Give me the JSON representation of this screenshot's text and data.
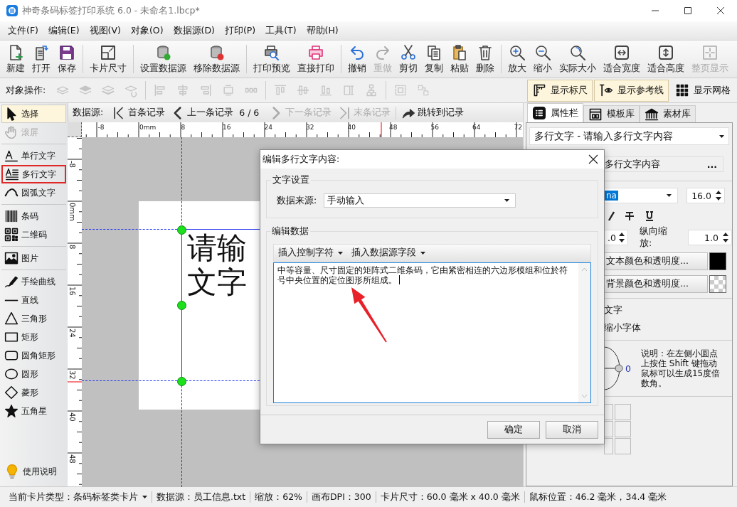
{
  "window": {
    "title": "神奇条码标签打印系统 6.0 - 未命名1.lbcp*"
  },
  "menu": [
    "文件(F)",
    "编辑(E)",
    "视图(V)",
    "对象(O)",
    "数据源(D)",
    "打印(P)",
    "工具(T)",
    "帮助(H)"
  ],
  "toolbar": [
    [
      {
        "label": "新建",
        "disabled": false
      },
      {
        "label": "打开",
        "disabled": false
      },
      {
        "label": "保存",
        "disabled": false
      }
    ],
    [
      {
        "label": "卡片尺寸",
        "disabled": false
      }
    ],
    [
      {
        "label": "设置数据源",
        "disabled": false
      },
      {
        "label": "移除数据源",
        "disabled": false
      }
    ],
    [
      {
        "label": "打印预览",
        "disabled": false
      },
      {
        "label": "直接打印",
        "disabled": false
      }
    ],
    [
      {
        "label": "撤销",
        "disabled": false
      },
      {
        "label": "重做",
        "disabled": true
      },
      {
        "label": "剪切",
        "disabled": false
      },
      {
        "label": "复制",
        "disabled": false
      },
      {
        "label": "粘贴",
        "disabled": false
      },
      {
        "label": "删除",
        "disabled": false
      }
    ],
    [
      {
        "label": "放大",
        "disabled": false
      },
      {
        "label": "缩小",
        "disabled": false
      },
      {
        "label": "实际大小",
        "disabled": false
      },
      {
        "label": "适合宽度",
        "disabled": false
      },
      {
        "label": "适合高度",
        "disabled": false
      },
      {
        "label": "整页显示",
        "disabled": true
      }
    ]
  ],
  "object_toolbar": {
    "label": "对象操作:",
    "tools": [
      [
        {
          "disabled": true
        },
        {
          "disabled": true
        },
        {
          "disabled": true
        },
        {
          "disabled": true
        }
      ],
      [
        {
          "disabled": true
        },
        {
          "disabled": true
        },
        {
          "disabled": true
        },
        {
          "disabled": true
        },
        {
          "disabled": true
        }
      ],
      [
        {
          "disabled": true
        },
        {
          "disabled": true
        },
        {
          "disabled": true
        },
        {
          "disabled": true
        },
        {
          "disabled": true
        }
      ],
      [
        {
          "disabled": true
        },
        {
          "disabled": true
        }
      ]
    ],
    "toggles": [
      {
        "label": "显示标尺",
        "on": true
      },
      {
        "label": "显示参考线",
        "on": true
      },
      {
        "label": "显示网格",
        "on": false
      }
    ]
  },
  "tools": [
    [
      {
        "label": "选择",
        "selected": true,
        "disabled": false,
        "highlighted": false
      },
      {
        "label": "滚屏",
        "selected": false,
        "disabled": true,
        "highlighted": false
      }
    ],
    [
      {
        "label": "单行文字",
        "selected": false,
        "disabled": false,
        "highlighted": false
      },
      {
        "label": "多行文字",
        "selected": false,
        "disabled": false,
        "highlighted": true
      },
      {
        "label": "圆弧文字",
        "selected": false,
        "disabled": false,
        "highlighted": false
      }
    ],
    [
      {
        "label": "条码",
        "selected": false,
        "disabled": false,
        "highlighted": false
      },
      {
        "label": "二维码",
        "selected": false,
        "disabled": false,
        "highlighted": false
      }
    ],
    [
      {
        "label": "图片",
        "selected": false,
        "disabled": false,
        "highlighted": false
      }
    ],
    [
      {
        "label": "手绘曲线",
        "selected": false,
        "disabled": false,
        "highlighted": false
      },
      {
        "label": "直线",
        "selected": false,
        "disabled": false,
        "highlighted": false
      },
      {
        "label": "三角形",
        "selected": false,
        "disabled": false,
        "highlighted": false
      },
      {
        "label": "矩形",
        "selected": false,
        "disabled": false,
        "highlighted": false
      },
      {
        "label": "圆角矩形",
        "selected": false,
        "disabled": false,
        "highlighted": false
      },
      {
        "label": "圆形",
        "selected": false,
        "disabled": false,
        "highlighted": false
      },
      {
        "label": "菱形",
        "selected": false,
        "disabled": false,
        "highlighted": false
      },
      {
        "label": "五角星",
        "selected": false,
        "disabled": false,
        "highlighted": false
      }
    ]
  ],
  "help_button": "使用说明",
  "record_nav": {
    "label": "数据源:",
    "buttons": [
      {
        "label": "首条记录",
        "disabled": false
      },
      {
        "label": "上一条记录",
        "disabled": false
      },
      {
        "label": "下一条记录",
        "disabled": true
      },
      {
        "label": "末条记录",
        "disabled": true
      }
    ],
    "position": "6 / 6",
    "jump": "跳转到记录"
  },
  "rulers": {
    "horizontal": [
      "-8",
      "0mm",
      "8",
      "16",
      "24",
      "32",
      "40",
      "48",
      "56",
      "64",
      "72"
    ],
    "vertical": [
      "-8",
      "0mm",
      "8",
      "16",
      "24",
      "32",
      "40",
      "48"
    ]
  },
  "canvas": {
    "text_lines": [
      "请输",
      "文字"
    ]
  },
  "panel": {
    "tabs": [
      {
        "label": "属性栏",
        "selected": true
      },
      {
        "label": "模板库",
        "selected": false
      },
      {
        "label": "素材库",
        "selected": false
      }
    ],
    "object_select": "多行文字 - 请输入多行文字内容",
    "content_field": "多行文字内容",
    "more": "...",
    "font": "na",
    "font_size": "16.0",
    "h_scale": ".0",
    "v_scale_label": "纵向缩放:",
    "v_scale": "1.0",
    "text_color_button": "文本颜色和透明度...",
    "bg_color_button": "背景颜色和透明度...",
    "checks": [
      "文字",
      "缩小字体"
    ],
    "angle": "0",
    "help": "说明：在左侧小圆点上按住 Shift 键拖动鼠标可以生成15度倍数角。"
  },
  "dialog": {
    "title": "编辑多行文字内容:",
    "settings_group": "文字设置",
    "source_label": "数据来源:",
    "source_value": "手动输入",
    "edit_group": "编辑数据",
    "insert_menus": [
      "插入控制字符",
      "插入数据源字段"
    ],
    "text": "中等容量、尺寸固定的矩阵式二维条码，它由紧密相连的六边形模组和位於符号中央位置的定位图形所组成。",
    "buttons": [
      "确定",
      "取消"
    ]
  },
  "status_bar": [
    "当前卡片类型：条码标签类卡片",
    "数据源：员工信息.txt",
    "缩放：62%",
    "画布DPI：300",
    "卡片尺寸：60.0 毫米 x 40.0 毫米",
    "鼠标位置：46.2 毫米，34.4 毫米"
  ]
}
